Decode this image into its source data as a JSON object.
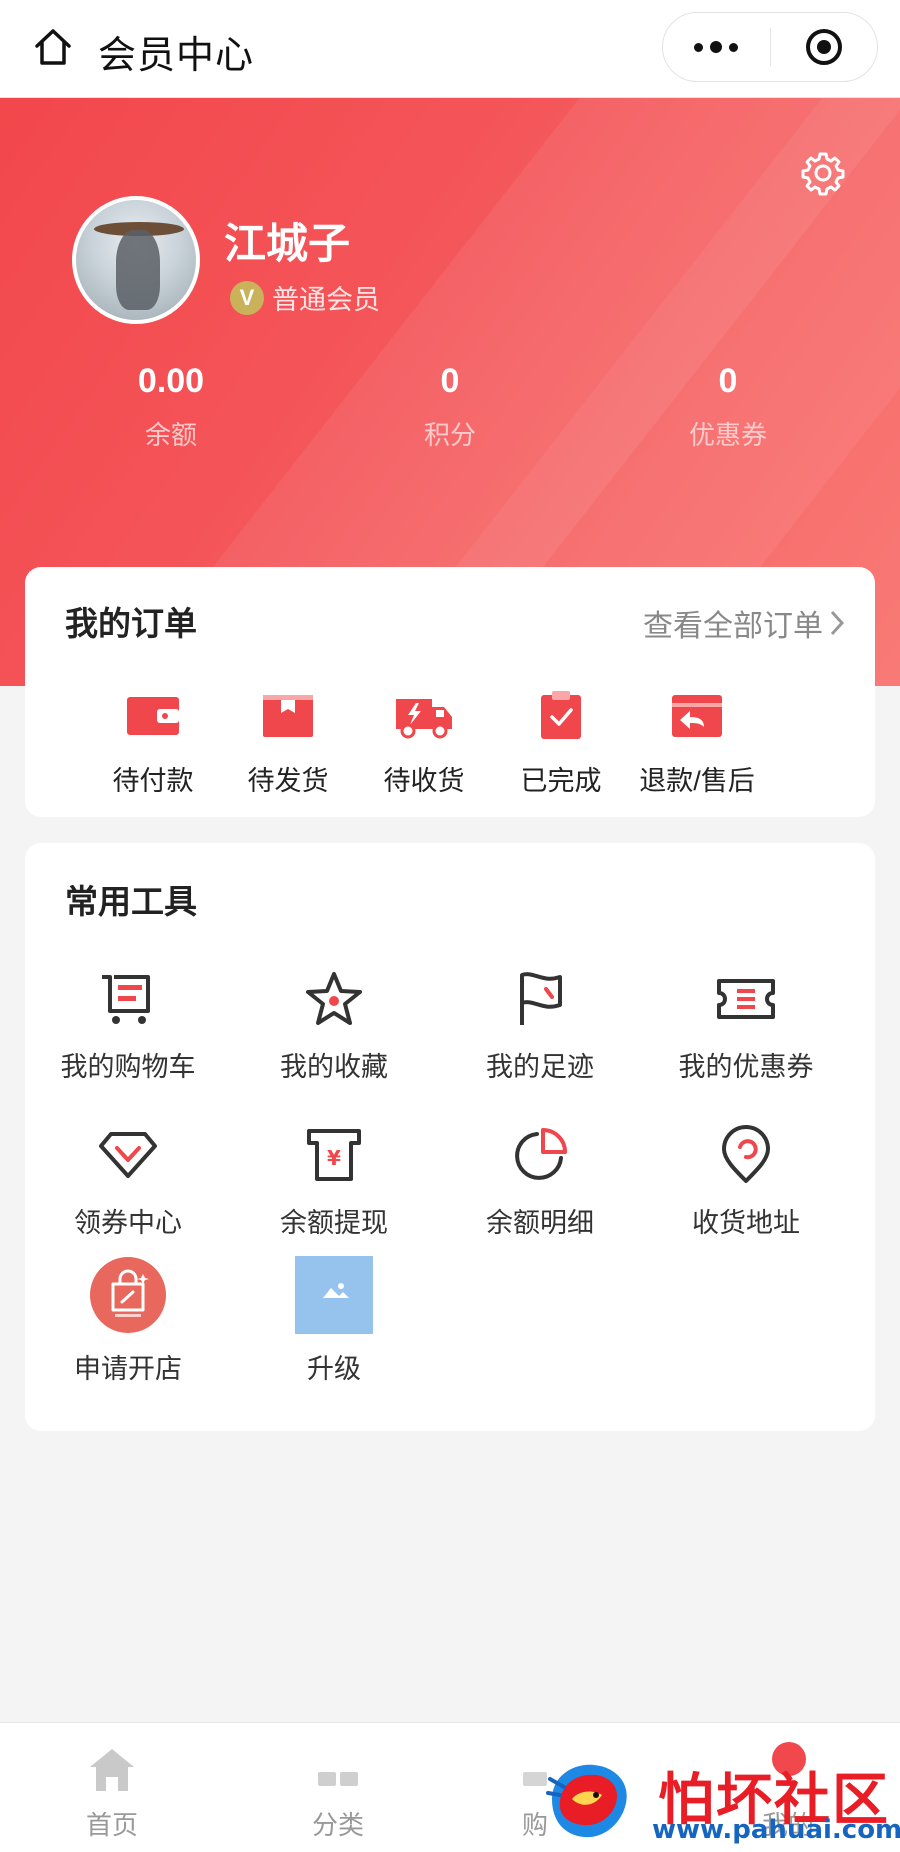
{
  "nav": {
    "title": "会员中心",
    "icons": [
      "home-icon",
      "more-icon",
      "target-icon"
    ]
  },
  "profile": {
    "name": "江城子",
    "level_badge": "V",
    "level": "普通会员",
    "stats": [
      {
        "value": "0.00",
        "label": "余额"
      },
      {
        "value": "0",
        "label": "积分"
      },
      {
        "value": "0",
        "label": "优惠券"
      }
    ]
  },
  "orders": {
    "title": "我的订单",
    "view_all": "查看全部订单",
    "items": [
      {
        "label": "待付款",
        "icon": "wallet-icon"
      },
      {
        "label": "待发货",
        "icon": "box-icon"
      },
      {
        "label": "待收货",
        "icon": "truck-icon"
      },
      {
        "label": "已完成",
        "icon": "clipboard-check-icon"
      },
      {
        "label": "退款/售后",
        "icon": "return-icon"
      }
    ]
  },
  "tools": {
    "title": "常用工具",
    "items": [
      {
        "label": "我的购物车",
        "icon": "cart-icon"
      },
      {
        "label": "我的收藏",
        "icon": "star-icon"
      },
      {
        "label": "我的足迹",
        "icon": "flag-icon"
      },
      {
        "label": "我的优惠券",
        "icon": "ticket-icon"
      },
      {
        "label": "领券中心",
        "icon": "diamond-icon"
      },
      {
        "label": "余额提现",
        "icon": "atm-icon"
      },
      {
        "label": "余额明细",
        "icon": "pie-icon"
      },
      {
        "label": "收货地址",
        "icon": "location-icon"
      },
      {
        "label": "申请开店",
        "icon": "shop-bag-icon"
      },
      {
        "label": "升级",
        "icon": "image-placeholder-icon"
      }
    ]
  },
  "tabbar": {
    "items": [
      {
        "label": "首页",
        "icon": "home-tab-icon"
      },
      {
        "label": "分类",
        "icon": "category-icon"
      },
      {
        "label": "购",
        "icon": "cart-tab-icon"
      },
      {
        "label": "我的",
        "icon": "user-tab-icon"
      }
    ]
  },
  "watermark": {
    "text": "怕坏社区",
    "url": "www.pahuai.com"
  },
  "colors": {
    "accent": "#f0484c",
    "icon_red": "#ef474b",
    "icon_dark": "#333333"
  }
}
